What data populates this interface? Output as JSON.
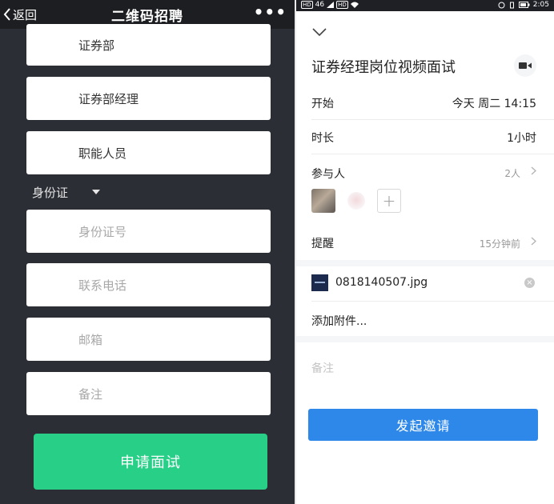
{
  "left": {
    "back_label": "返回",
    "title": "二维码招聘",
    "more_label": "•••",
    "fields_top": [
      {
        "value": "证券部"
      },
      {
        "value": "证券部经理"
      },
      {
        "value": "职能人员"
      }
    ],
    "id_type_select": "身份证",
    "fields_bottom": [
      {
        "placeholder": "身份证号"
      },
      {
        "placeholder": "联系电话"
      },
      {
        "placeholder": "邮箱"
      },
      {
        "placeholder": "备注"
      }
    ],
    "apply_button": "申请面试",
    "colors": {
      "background": "#2b2e35",
      "accent": "#27cf87"
    }
  },
  "right": {
    "statusbar": {
      "left_badges": [
        "HD",
        "46",
        "HD"
      ],
      "time": "2:05"
    },
    "title": "证券经理岗位视频面试",
    "rows": {
      "start": {
        "label": "开始",
        "value": "今天 周二 14:15"
      },
      "duration": {
        "label": "时长",
        "value": "1小时"
      },
      "participants": {
        "label": "参与人",
        "value": "2人"
      },
      "reminder": {
        "label": "提醒",
        "value": "15分钟前"
      }
    },
    "attachment": {
      "file_name": "0818140507.jpg"
    },
    "add_attachment": "添加附件...",
    "notes_placeholder": "备注",
    "invite_button": "发起邀请",
    "colors": {
      "accent": "#2d88e9"
    }
  }
}
